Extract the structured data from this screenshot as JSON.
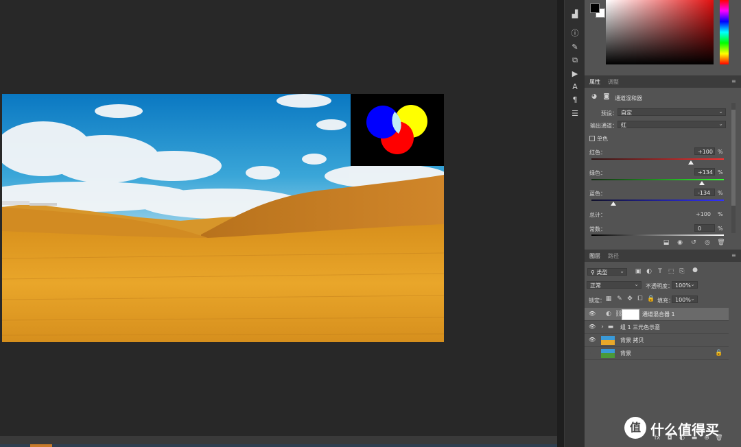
{
  "colors": {
    "foreground": "#000000",
    "background": "#ffffff",
    "accent_orange": "#c87a2a"
  },
  "toolbar": {
    "icons": [
      "histogram-icon",
      "info-icon",
      "brush-settings-icon",
      "clone-source-icon",
      "play-action-icon",
      "character-icon",
      "paragraph-icon",
      "adjustment-sliders-icon"
    ]
  },
  "properties": {
    "tabs": [
      "属性",
      "调整"
    ],
    "header_title": "通道混和器",
    "preset_label": "预设：",
    "preset_value": "自定",
    "output_channel_label": "输出通道：",
    "output_channel_value": "红",
    "monochrome_label": "单色",
    "red": {
      "label": "红色：",
      "value": "+100",
      "unit": "%",
      "level": 100
    },
    "green": {
      "label": "绿色：",
      "value": "+134",
      "unit": "%",
      "level": 134
    },
    "blue": {
      "label": "蓝色：",
      "value": "-134",
      "unit": "%",
      "level": -134
    },
    "total": {
      "label": "总计：",
      "value": "+100",
      "unit": "%"
    },
    "constant": {
      "label": "常数：",
      "value": "0",
      "unit": "%",
      "level": 0
    }
  },
  "layers_panel": {
    "tabs": [
      "图层",
      "路径"
    ],
    "filter_label": "类型",
    "blend_mode": "正常",
    "opacity_label": "不透明度：",
    "opacity_value": "100%",
    "lock_label": "锁定：",
    "fill_label": "填充：",
    "fill_value": "100%",
    "layers": [
      {
        "name": "通道混合器 1",
        "visible": true,
        "selected": true
      },
      {
        "name": "组 1 三元色示意",
        "visible": true,
        "selected": false
      },
      {
        "name": "背景 拷贝",
        "visible": true,
        "selected": false
      },
      {
        "name": "背景",
        "visible": false,
        "selected": false
      }
    ],
    "footer_icons": [
      "link-icon",
      "fx-icon",
      "mask-icon",
      "adjustment-icon",
      "group-icon",
      "new-layer-icon",
      "trash-icon"
    ]
  },
  "watermark": {
    "text": "什么值得买",
    "logo": "值"
  }
}
